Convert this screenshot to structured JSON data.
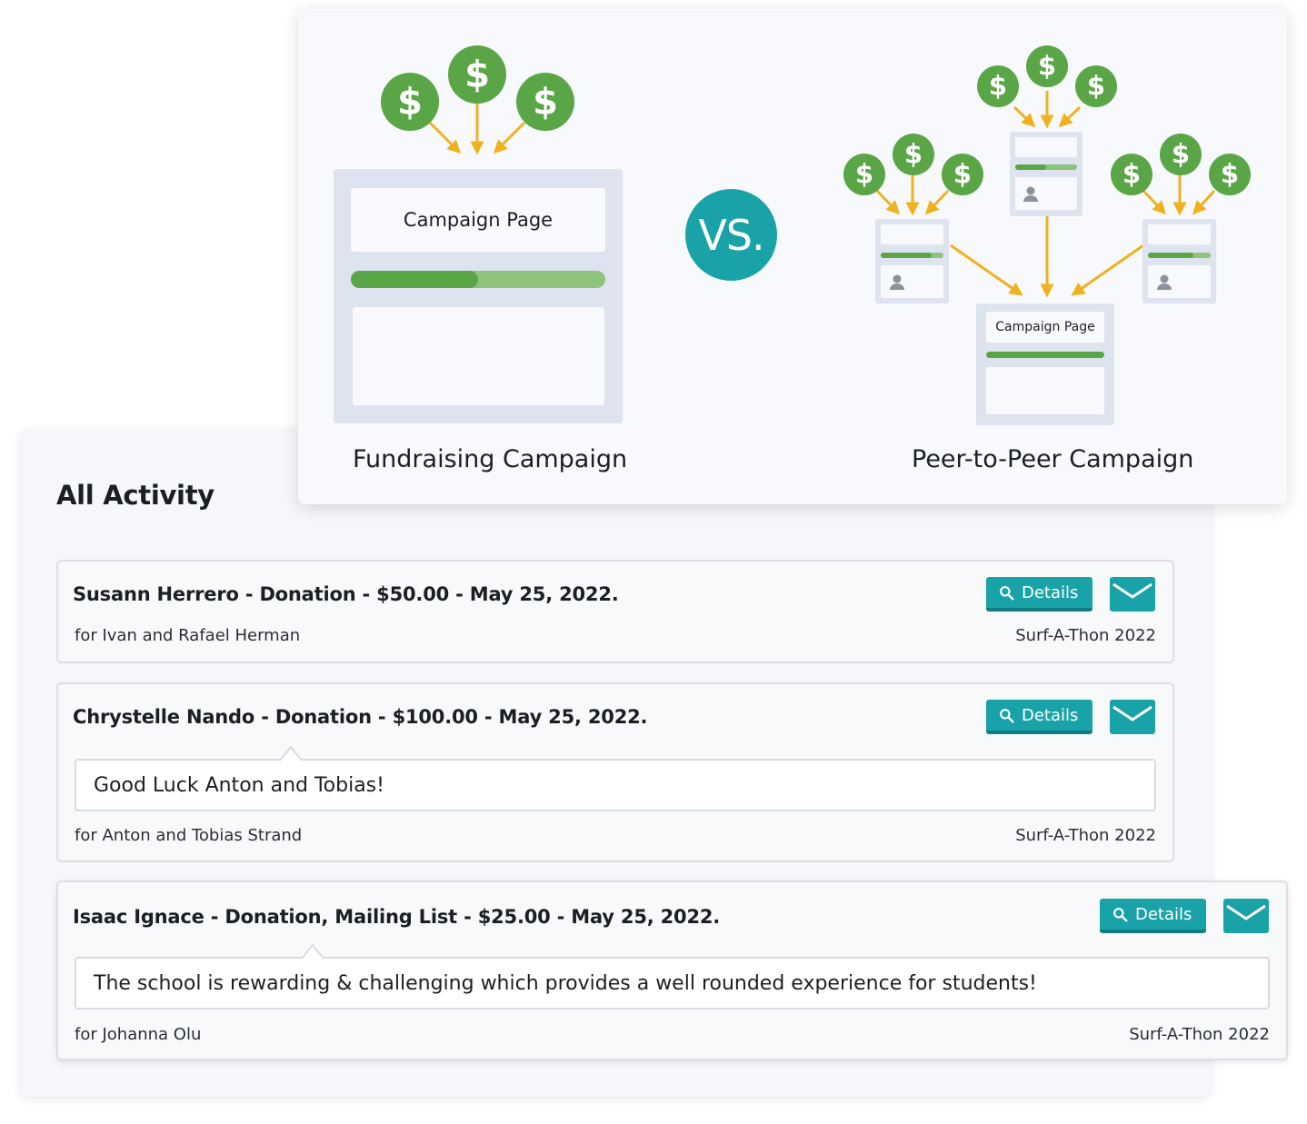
{
  "compare": {
    "left_caption": "Fundraising Campaign",
    "right_caption": "Peer-to-Peer Campaign",
    "big_page_title": "Campaign Page",
    "small_page_title": "Campaign Page",
    "vs_label": "VS.",
    "dollar_glyph": "$",
    "big_page_progress": 0.5,
    "colors": {
      "green": "#5aa646",
      "arrow": "#f0b11f",
      "teal": "#19a3a9",
      "page": "#dde3ef"
    }
  },
  "activity": {
    "title": "All Activity",
    "details_label": "Details",
    "items": [
      {
        "title": "Susann Herrero - Donation - $50.00 - May 25, 2022.",
        "for": "for Ivan and Rafael Herman",
        "campaign": "Surf-A-Thon 2022"
      },
      {
        "title": "Chrystelle Nando - Donation - $100.00 - May 25, 2022.",
        "message": "Good Luck Anton and Tobias!",
        "for": "for Anton and Tobias Strand",
        "campaign": "Surf-A-Thon 2022"
      },
      {
        "title": "Isaac Ignace - Donation, Mailing List - $25.00 - May 25, 2022.",
        "message": "The school is rewarding & challenging which provides a well rounded experience for students!",
        "for": "for Johanna Olu",
        "campaign": "Surf-A-Thon 2022"
      }
    ]
  }
}
